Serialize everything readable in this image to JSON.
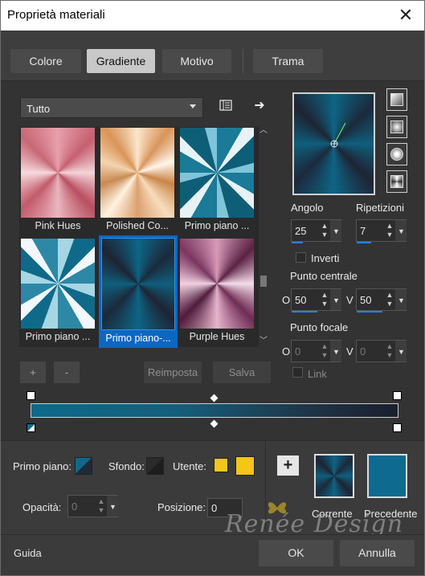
{
  "window": {
    "title": "Proprietà materiali",
    "close_icon": "close-icon"
  },
  "tabs": [
    {
      "label": "Colore"
    },
    {
      "label": "Gradiente",
      "active": true
    },
    {
      "label": "Motivo"
    },
    {
      "label": "Trama"
    }
  ],
  "library": {
    "category": "Tutto",
    "category_arrow_icon": "chevron-down-icon",
    "menu_icon": "book-menu-icon",
    "arrow_icon": "arrow-right-icon",
    "items": [
      {
        "label": "Pink Hues"
      },
      {
        "label": "Polished Co..."
      },
      {
        "label": "Primo piano ..."
      },
      {
        "label": "Primo piano ..."
      },
      {
        "label": "Primo piano-...",
        "selected": true
      },
      {
        "label": "Purple Hues"
      }
    ],
    "scrollbar_level": 0.55
  },
  "buttons": {
    "add": "+",
    "remove": "-",
    "reset": "Reimposta",
    "save": "Salva"
  },
  "gradient_settings": {
    "angle_label": "Angolo",
    "angle_value": "25",
    "repeat_label": "Ripetizioni",
    "repeat_value": "7",
    "invert_label": "Inverti",
    "invert_checked": false,
    "center_label": "Punto centrale",
    "center_o_label": "O",
    "center_o_value": "50",
    "center_v_label": "V",
    "center_v_value": "50",
    "focal_label": "Punto focale",
    "focal_o_label": "O",
    "focal_o_value": "0",
    "focal_v_label": "V",
    "focal_v_value": "0",
    "link_label": "Link",
    "link_checked": false
  },
  "colors": {
    "primary_label": "Primo piano:",
    "background_label": "Sfondo:",
    "user_label": "Utente:",
    "user_color": "#f5c518",
    "opacity_label": "Opacità:",
    "opacity_value": "0",
    "position_label": "Posizione:",
    "position_value": "0",
    "add_icon": "plus-icon",
    "current_label": "Corrente",
    "previous_label": "Precedente",
    "previous_color": "#0f6a8f"
  },
  "footer": {
    "help": "Guida",
    "ok": "OK",
    "cancel": "Annulla"
  },
  "watermark": "Renée Design"
}
